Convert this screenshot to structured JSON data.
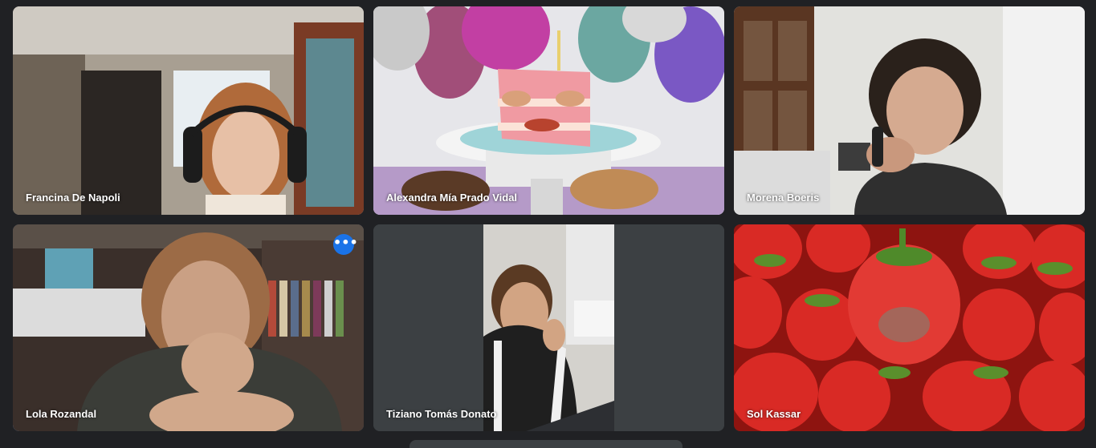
{
  "participants": [
    {
      "name": "Francina De Napoli"
    },
    {
      "name": "Alexandra Mía Prado Vidal"
    },
    {
      "name": "Morena Boeris"
    },
    {
      "name": "Lola Rozandal",
      "active_speaker": true,
      "more_options_label": "•••"
    },
    {
      "name": "Tiziano Tomás Donato"
    },
    {
      "name": "Sol Kassar"
    }
  ],
  "colors": {
    "background": "#202124",
    "tile": "#3c4043",
    "active_outline": "#8ab4f8",
    "more_button": "#1a73e8"
  }
}
